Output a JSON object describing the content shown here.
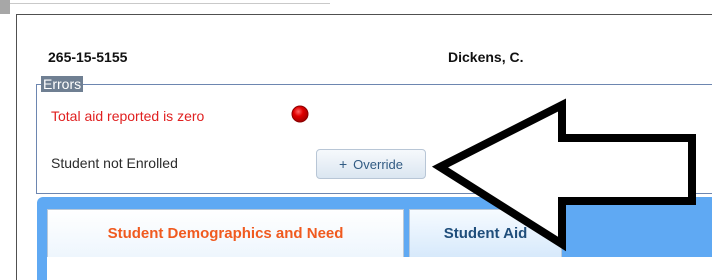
{
  "record": {
    "ssn": "265-15-5155",
    "name": "Dickens, C."
  },
  "errors": {
    "title": "Errors",
    "messages": [
      {
        "text": "Total aid reported is zero",
        "status_icon": "stop-icon",
        "color": "#e02020"
      },
      {
        "text": "Student not Enrolled",
        "action_label": "Override",
        "action_icon": "plus-icon"
      }
    ]
  },
  "tabs": [
    {
      "label": "Student Demographics and Need",
      "active": true
    },
    {
      "label": "Student Aid",
      "active": false
    }
  ],
  "annotation": {
    "arrow_icon": "left-arrow-icon"
  },
  "colors": {
    "error_text": "#e02020",
    "tab_band": "#5fa9f3",
    "active_tab_text": "#f05a1f",
    "inactive_tab_text": "#1f4e7b"
  }
}
